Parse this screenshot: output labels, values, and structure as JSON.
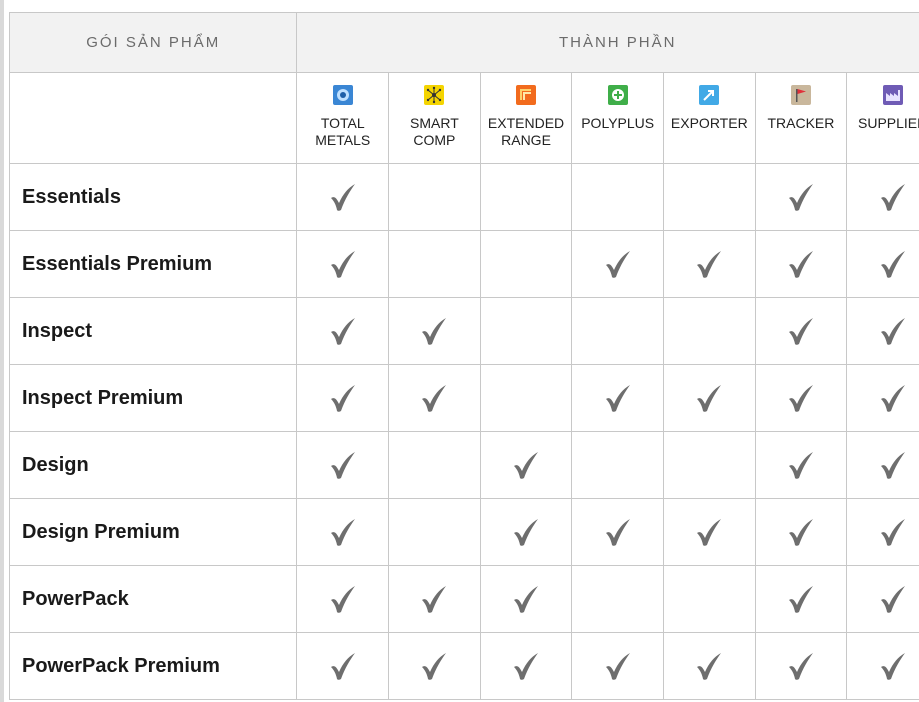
{
  "header": {
    "packages_label": "GÓI SẢN PHẨM",
    "components_label": "THÀNH PHẦN"
  },
  "components": [
    {
      "label": "TOTAL\nMETALS",
      "icon": "total-metals-icon",
      "color": "#3a86d4"
    },
    {
      "label": "SMART\nCOMP",
      "icon": "smart-comp-icon",
      "color": "#f4d400"
    },
    {
      "label": "EXTENDED\nRANGE",
      "icon": "extended-range-icon",
      "color": "#f26b1d"
    },
    {
      "label": "POLYPLUS",
      "icon": "polyplus-icon",
      "color": "#3fae49"
    },
    {
      "label": "EXPORTER",
      "icon": "exporter-icon",
      "color": "#41a9e6"
    },
    {
      "label": "TRACKER",
      "icon": "tracker-icon",
      "color": "#c9b79c"
    },
    {
      "label": "SUPPLIER",
      "icon": "supplier-icon",
      "color": "#6f5bb5"
    }
  ],
  "rows": [
    {
      "name": "Essentials",
      "checks": [
        true,
        false,
        false,
        false,
        false,
        true,
        true
      ]
    },
    {
      "name": "Essentials Premium",
      "checks": [
        true,
        false,
        false,
        true,
        true,
        true,
        true
      ]
    },
    {
      "name": "Inspect",
      "checks": [
        true,
        true,
        false,
        false,
        false,
        true,
        true
      ]
    },
    {
      "name": "Inspect Premium",
      "checks": [
        true,
        true,
        false,
        true,
        true,
        true,
        true
      ]
    },
    {
      "name": "Design",
      "checks": [
        true,
        false,
        true,
        false,
        false,
        true,
        true
      ]
    },
    {
      "name": "Design Premium",
      "checks": [
        true,
        false,
        true,
        true,
        true,
        true,
        true
      ]
    },
    {
      "name": "PowerPack",
      "checks": [
        true,
        true,
        true,
        false,
        false,
        true,
        true
      ]
    },
    {
      "name": "PowerPack Premium",
      "checks": [
        true,
        true,
        true,
        true,
        true,
        true,
        true
      ]
    }
  ],
  "check_color": "#6e6e6e"
}
